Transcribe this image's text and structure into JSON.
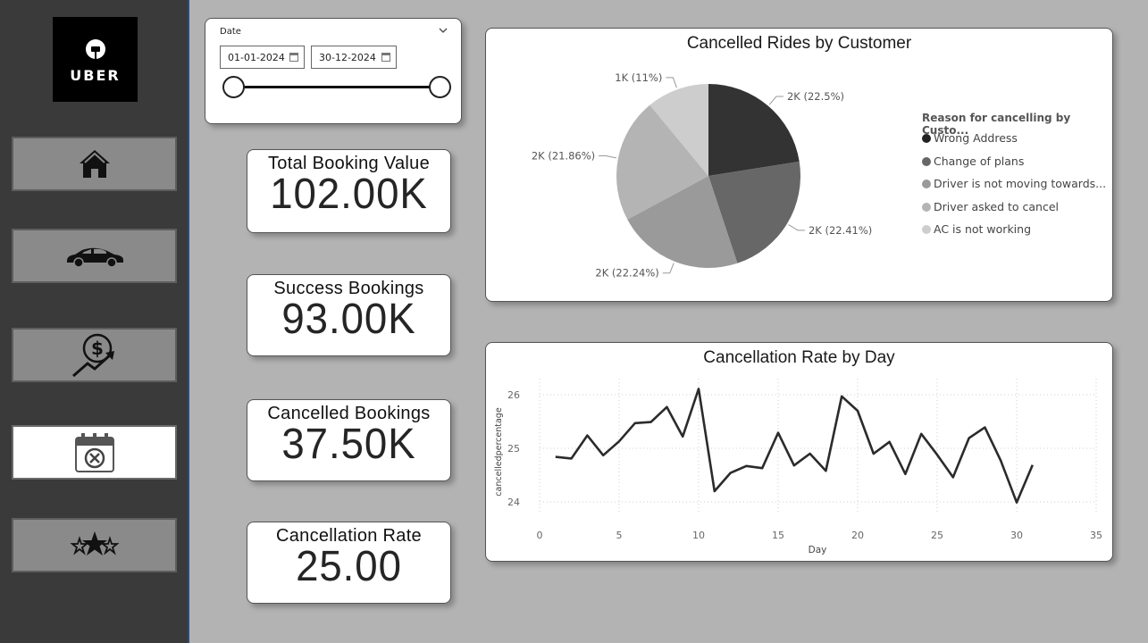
{
  "logo": {
    "text": "UBER"
  },
  "nav": [
    {
      "icon": "home-icon",
      "active": false
    },
    {
      "icon": "car-icon",
      "active": false
    },
    {
      "icon": "revenue-growth-icon",
      "active": false
    },
    {
      "icon": "calendar-cancel-icon",
      "active": true
    },
    {
      "icon": "stars-rating-icon",
      "active": false
    }
  ],
  "slicer": {
    "title": "Date",
    "start": "01-01-2024",
    "end": "30-12-2024"
  },
  "kpis": {
    "total": {
      "title": "Total Booking Value",
      "value": "102.00K"
    },
    "success": {
      "title": "Success Bookings",
      "value": "93.00K"
    },
    "cancelled": {
      "title": "Cancelled Bookings",
      "value": "37.50K"
    },
    "rate": {
      "title": "Cancellation Rate",
      "value": "25.00"
    }
  },
  "chart_data": [
    {
      "type": "pie",
      "title": "Cancelled Rides by Customer",
      "legend_title": "Reason for cancelling by Custo...",
      "legend_position": "right",
      "slices": [
        {
          "name": "Wrong Address",
          "label": "2K (22.5%)",
          "percent": 22.5,
          "color": "#333333"
        },
        {
          "name": "Change of plans",
          "label": "2K (22.41%)",
          "percent": 22.41,
          "color": "#676767"
        },
        {
          "name": "Driver is not moving towards...",
          "label": "2K (22.24%)",
          "percent": 22.24,
          "color": "#9a9a9a"
        },
        {
          "name": "Driver asked to cancel",
          "label": "2K (21.86%)",
          "percent": 21.86,
          "color": "#b4b4b4"
        },
        {
          "name": "AC is not working",
          "label": "1K (11%)",
          "percent": 11,
          "color": "#cdcdcd"
        }
      ]
    },
    {
      "type": "line",
      "title": "Cancellation Rate by Day",
      "xlabel": "Day",
      "ylabel": "cancelledpercentage",
      "xlim": [
        0,
        35
      ],
      "ylim": [
        23.8,
        26.3
      ],
      "xticks": [
        0,
        5,
        10,
        15,
        20,
        25,
        30,
        35
      ],
      "yticks": [
        24,
        25,
        26
      ],
      "grid": true,
      "color": "#2b2b2b",
      "x": [
        1,
        2,
        3,
        4,
        5,
        6,
        7,
        8,
        9,
        10,
        11,
        12,
        13,
        14,
        15,
        16,
        17,
        18,
        19,
        20,
        21,
        22,
        23,
        24,
        25,
        26,
        27,
        28,
        29,
        30,
        31
      ],
      "y": [
        24.84,
        24.81,
        25.24,
        24.87,
        25.13,
        25.47,
        25.49,
        25.77,
        25.22,
        26.11,
        24.2,
        24.54,
        24.67,
        24.63,
        25.29,
        24.68,
        24.9,
        24.58,
        25.97,
        25.7,
        24.9,
        25.12,
        24.52,
        25.27,
        24.88,
        24.46,
        25.19,
        25.39,
        24.77,
        23.99,
        24.69
      ]
    }
  ]
}
